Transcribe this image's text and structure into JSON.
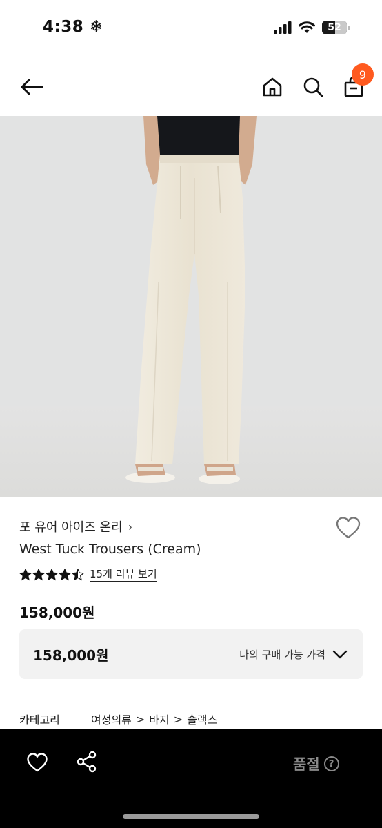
{
  "status_bar": {
    "time": "4:38",
    "battery_level": "52",
    "battery_fraction": 0.52
  },
  "nav": {
    "cart_count": "9"
  },
  "product": {
    "brand": "포 유어 아이즈 온리",
    "title": "West Tuck Trousers (Cream)",
    "rating": 4.5,
    "review_link": "15개 리뷰 보기",
    "price": "158,000원"
  },
  "my_price": {
    "value": "158,000원",
    "label": "나의 구매 가능 가격"
  },
  "category": {
    "label": "카테고리",
    "path": [
      "여성의류",
      "바지",
      "슬랙스"
    ]
  },
  "bottom_bar": {
    "status": "품절",
    "help": "?"
  },
  "colors": {
    "accent": "#ff5a1f",
    "bottom_bar": "#000000",
    "muted": "#8a8a8a",
    "trousers": "#ece6d6"
  }
}
